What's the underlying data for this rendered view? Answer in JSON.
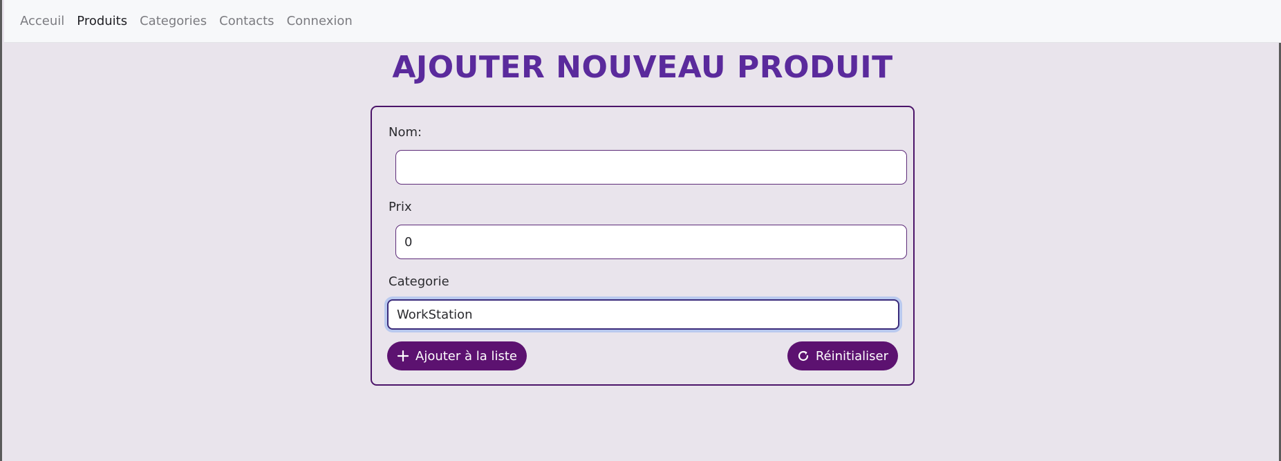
{
  "nav": {
    "items": [
      {
        "label": "Acceuil",
        "active": false
      },
      {
        "label": "Produits",
        "active": true
      },
      {
        "label": "Categories",
        "active": false
      },
      {
        "label": "Contacts",
        "active": false
      },
      {
        "label": "Connexion",
        "active": false
      }
    ]
  },
  "page": {
    "title": "AJOUTER NOUVEAU PRODUIT"
  },
  "form": {
    "nom": {
      "label": "Nom:",
      "value": ""
    },
    "prix": {
      "label": "Prix",
      "value": "0"
    },
    "categorie": {
      "label": "Categorie",
      "selected": "WorkStation"
    },
    "add_button": "Ajouter à la liste",
    "reset_button": "Réinitialiser"
  },
  "colors": {
    "title": "#5a2a9c",
    "button": "#5c1270",
    "card_border": "#4b1469",
    "background": "#e9e4ec"
  },
  "icons": {
    "add": "plus-icon",
    "reset": "refresh-icon"
  }
}
